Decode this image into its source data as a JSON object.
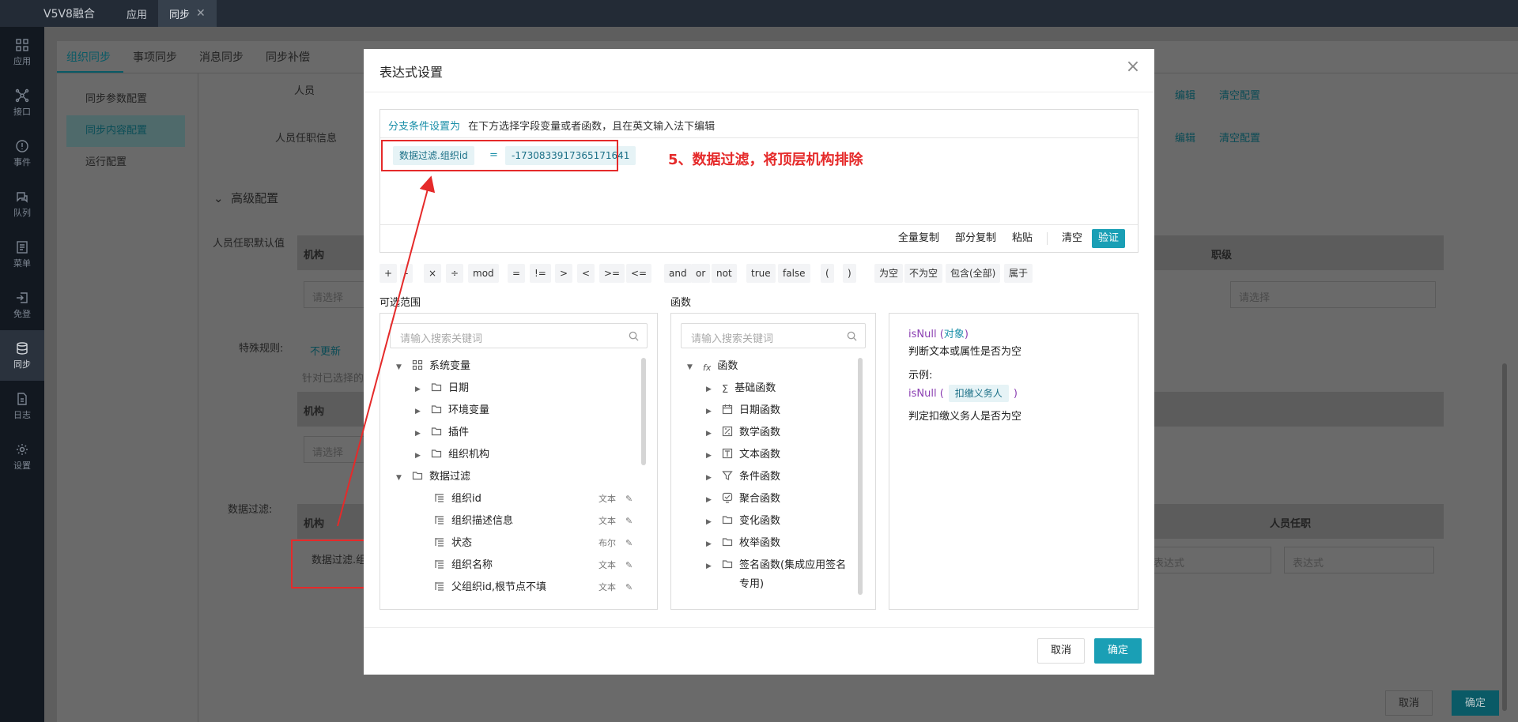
{
  "topbar": {
    "app_name": "V5V8融合",
    "tabs": [
      {
        "label": "应用"
      },
      {
        "label": "同步"
      }
    ],
    "close_glyph": "✕"
  },
  "sidebar": {
    "items": [
      {
        "label": "应用",
        "icon": "grid-icon"
      },
      {
        "label": "接口",
        "icon": "nodes-icon"
      },
      {
        "label": "事件",
        "icon": "alert-icon"
      },
      {
        "label": "队列",
        "icon": "queue-icon"
      },
      {
        "label": "菜单",
        "icon": "menu-icon"
      },
      {
        "label": "免登",
        "icon": "login-icon"
      },
      {
        "label": "同步",
        "icon": "database-icon"
      },
      {
        "label": "日志",
        "icon": "log-icon"
      },
      {
        "label": "设置",
        "icon": "gear-icon"
      }
    ]
  },
  "background": {
    "subtabs": [
      "组织同步",
      "事项同步",
      "消息同步",
      "同步补偿"
    ],
    "leftnav": [
      "同步参数配置",
      "同步内容配置",
      "运行配置"
    ],
    "row1_label": "人员",
    "row2_label": "人员任职信息",
    "edit_link": "编辑",
    "clear_link": "清空配置",
    "advanced": "高级配置",
    "default_label": "人员任职默认值",
    "col_org": "机构",
    "col_rank": "职级",
    "col_post": "人员任职",
    "placeholder_select": "请选择",
    "placeholder_expr": "表达式",
    "special_label": "特殊规则:",
    "no_update": "不更新",
    "special_hint": "针对已选择的",
    "filter_label": "数据过滤:",
    "filter_cell": "数据过滤.组",
    "cancel": "取消",
    "confirm": "确定"
  },
  "dialog": {
    "title": "表达式设置",
    "hint_key": "分支条件设置为",
    "hint_text": "在下方选择字段变量或者函数，且在英文输入法下编辑",
    "expr_field": "数据过滤.组织id",
    "expr_op": "=",
    "expr_value": "-1730833917365171641",
    "tools": [
      "全量复制",
      "部分复制",
      "粘贴",
      "清空",
      "验证"
    ],
    "ops": [
      "+",
      "-",
      "×",
      "÷",
      "mod",
      "=",
      "!=",
      ">",
      "<",
      ">=",
      "<=",
      "and",
      "or",
      "not",
      "true",
      "false",
      "(",
      ")",
      "为空",
      "不为空",
      "包含(全部)",
      "属于"
    ],
    "scope_label": "可选范围",
    "func_label": "函数",
    "search_placeholder": "请输入搜索关键词",
    "scope_tree": [
      {
        "label": "系统变量",
        "level": 0,
        "expanded": true,
        "icon": "grid-icon"
      },
      {
        "label": "日期",
        "level": 1,
        "icon": "folder-icon"
      },
      {
        "label": "环境变量",
        "level": 1,
        "icon": "folder-icon"
      },
      {
        "label": "插件",
        "level": 1,
        "icon": "folder-icon"
      },
      {
        "label": "组织机构",
        "level": 1,
        "icon": "folder-icon"
      },
      {
        "label": "数据过滤",
        "level": 0,
        "expanded": true,
        "icon": "folder-icon"
      },
      {
        "label": "组织id",
        "level": 2,
        "tag": "文本",
        "icon": "field-icon"
      },
      {
        "label": "组织描述信息",
        "level": 2,
        "tag": "文本",
        "icon": "field-icon"
      },
      {
        "label": "状态",
        "level": 2,
        "tag": "布尔",
        "icon": "field-icon"
      },
      {
        "label": "组织名称",
        "level": 2,
        "tag": "文本",
        "icon": "field-icon"
      },
      {
        "label": "父组织id,根节点不填",
        "level": 2,
        "tag": "文本",
        "icon": "field-icon"
      }
    ],
    "func_tree": [
      {
        "label": "函数",
        "level": 0,
        "icon": "fx-icon"
      },
      {
        "label": "基础函数",
        "level": 1,
        "icon": "sigma-icon"
      },
      {
        "label": "日期函数",
        "level": 1,
        "icon": "calendar-icon"
      },
      {
        "label": "数学函数",
        "level": 1,
        "icon": "math-icon"
      },
      {
        "label": "文本函数",
        "level": 1,
        "icon": "text-icon"
      },
      {
        "label": "条件函数",
        "level": 1,
        "icon": "filter-icon"
      },
      {
        "label": "聚合函数",
        "level": 1,
        "icon": "aggregate-icon"
      },
      {
        "label": "变化函数",
        "level": 1,
        "icon": "folder-icon"
      },
      {
        "label": "枚举函数",
        "level": 1,
        "icon": "folder-icon"
      },
      {
        "label": "签名函数(集成应用签名",
        "level": 1,
        "icon": "folder-icon"
      },
      {
        "label": "专用)",
        "level": 1,
        "continuation": true
      }
    ],
    "desc": {
      "fn": "isNull",
      "param": "对象",
      "line1": "判断文本或属性是否为空",
      "example_label": "示例:",
      "example_fn": "isNull",
      "example_arg": "扣缴义务人",
      "example_desc": "判定扣缴义务人是否为空"
    },
    "cancel": "取消",
    "confirm": "确定"
  },
  "annotation": {
    "text": "5、数据过滤，将顶层机构排除",
    "color": "#e52a2a"
  }
}
